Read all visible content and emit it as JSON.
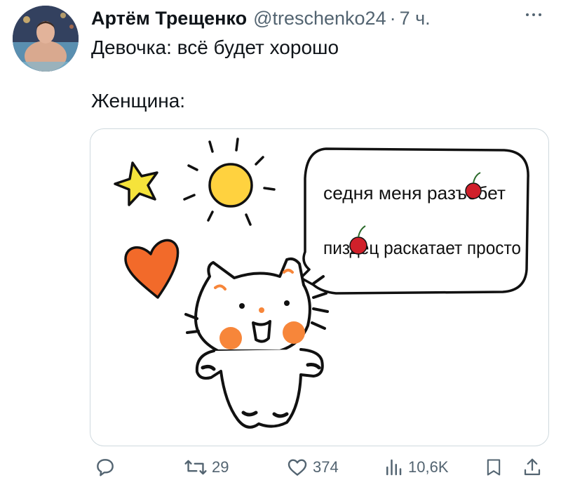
{
  "tweet": {
    "author_name": "Артём Трещенко",
    "handle": "@treschenko24",
    "separator": "·",
    "time": "7 ч.",
    "text_line1": "Девочка: всё будет хорошо",
    "text_line2": "Женщина:"
  },
  "media": {
    "bubble_line1": "седня меня разъебет",
    "bubble_line2": "пиздец раскатает просто",
    "colors": {
      "sun": "#ffd23f",
      "star": "#f5e33b",
      "heart": "#f26a2a",
      "cheeks": "#f7863a"
    }
  },
  "actions": {
    "reply_icon": "reply-icon",
    "retweet_count": "29",
    "like_count": "374",
    "views_count": "10,6K"
  }
}
